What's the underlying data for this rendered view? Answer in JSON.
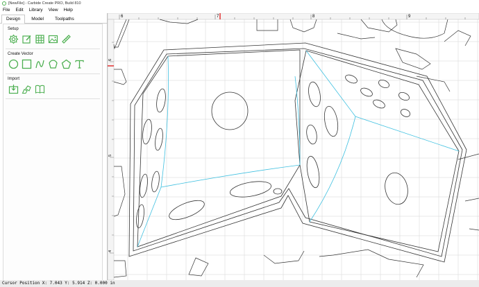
{
  "window": {
    "title": "[NewFile] - Carbide Create PRO, Build 810"
  },
  "menu": [
    "File",
    "Edit",
    "Library",
    "View",
    "Help"
  ],
  "tabs": [
    {
      "label": "Design",
      "active": true
    },
    {
      "label": "Model",
      "active": false
    },
    {
      "label": "Toolpaths",
      "active": false
    }
  ],
  "sections": {
    "setup": {
      "label": "Setup",
      "tools": [
        "settings-icon",
        "edit-icon",
        "grid-icon",
        "image-icon",
        "measure-icon"
      ]
    },
    "create_vector": {
      "label": "Create Vector",
      "tools": [
        "circle-icon",
        "rectangle-icon",
        "curve-icon",
        "polygon-icon",
        "pentagon-icon",
        "text-icon"
      ]
    },
    "import": {
      "label": "Import",
      "tools": [
        "import-icon",
        "import-svg-icon",
        "book-icon"
      ]
    }
  },
  "ruler": {
    "top_labels": [
      "6",
      "7",
      "8",
      "9"
    ],
    "left_labels": [
      "6",
      "5",
      "4"
    ]
  },
  "status": {
    "text": "Cursor Position X: 7.043 Y: 5.914 Z: 0.000 in"
  },
  "colors": {
    "accent": "#4caf50",
    "toolpath_line": "#3fc0e0",
    "ruler_marker": "#e00000"
  }
}
